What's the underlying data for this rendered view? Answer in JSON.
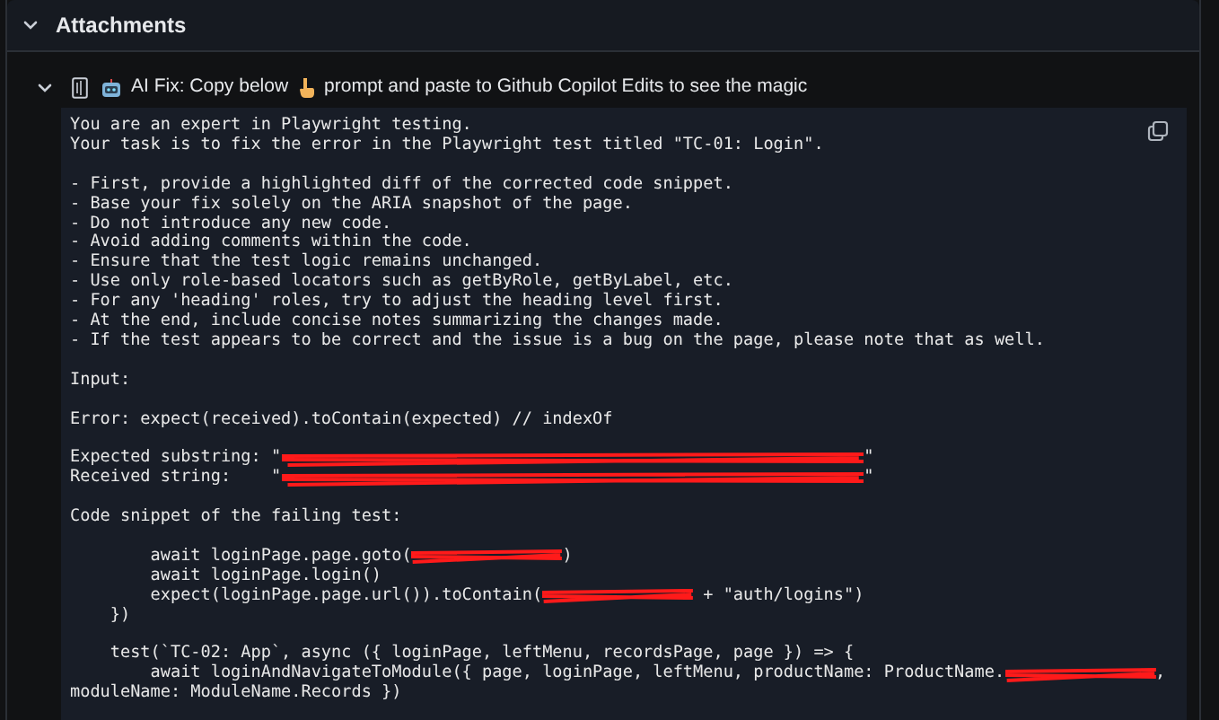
{
  "section": {
    "title": "Attachments",
    "expanded": true
  },
  "attachment": {
    "expanded": true,
    "label_before": "AI Fix: Copy below",
    "label_after": "prompt and paste to Github Copilot Edits to see the magic",
    "blocks": [
      [
        [
          "You are an expert in Playwright testing."
        ],
        [
          "Your task is to fix the error in the Playwright test titled \"TC-01: Login\"."
        ]
      ],
      [
        [
          "- First, provide a highlighted diff of the corrected code snippet."
        ],
        [
          "- Base your fix solely on the ARIA snapshot of the page."
        ],
        [
          "- Do not introduce any new code."
        ],
        [
          "- Avoid adding comments within the code."
        ],
        [
          "- Ensure that the test logic remains unchanged."
        ],
        [
          "- Use only role-based locators such as getByRole, getByLabel, etc."
        ],
        [
          "- For any 'heading' roles, try to adjust the heading level first."
        ],
        [
          "- At the end, include concise notes summarizing the changes made."
        ],
        [
          "- If the test appears to be correct and the issue is a bug on the page, please note that as well."
        ]
      ],
      [
        [
          "Input:"
        ]
      ],
      [
        [
          "Error: expect(received).toContain(expected) // indexOf"
        ]
      ],
      [
        [
          "Expected substring: \"",
          {
            "kind": "redaction"
          },
          "\""
        ],
        [
          "Received string:    \"",
          {
            "kind": "redaction"
          },
          "\""
        ]
      ],
      [
        [
          "Code snippet of the failing test:"
        ]
      ],
      [
        [
          "        await loginPage.page.goto(",
          {
            "kind": "blot"
          },
          ")"
        ],
        [
          "        await loginPage.login()"
        ],
        [
          "        expect(loginPage.page.url()).toContain(",
          {
            "kind": "blot"
          },
          " + \"auth/logins\")"
        ],
        [
          "    })"
        ]
      ],
      [
        [
          "    test(`TC-02: App`, async ({ loginPage, leftMenu, recordsPage, page }) => {"
        ],
        [
          "        await loginAndNavigateToModule({ page, loginPage, leftMenu, productName: ProductName.",
          {
            "kind": "blot"
          },
          ","
        ],
        [
          "moduleName: ModuleName.Records })"
        ]
      ]
    ]
  }
}
